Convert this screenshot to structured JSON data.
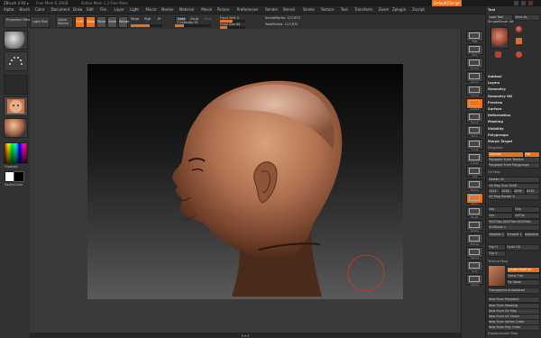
{
  "titlebar": {
    "app": "ZBrush 4 R4 ▸",
    "segments": [
      "Free Mem 6.39GB",
      "Active Mem 1.2 Free Mem",
      "Tool",
      "Poly 21,974",
      "Timer"
    ],
    "default_script": "DefaultZScript"
  },
  "menu": [
    "Alpha",
    "Brush",
    "Color",
    "Document",
    "Draw",
    "Edit",
    "File",
    "Layer",
    "Light",
    "Macro",
    "Marker",
    "Material",
    "Movie",
    "Picture",
    "Preferences",
    "Render",
    "Stencil",
    "Stroke",
    "Texture",
    "Tool",
    "Transform",
    "Zoom",
    "Zplugin",
    "Zscript"
  ],
  "toolbar": {
    "projection_master": "Projection Master",
    "lightbox": "Light Box",
    "quick_sketch": "Quick Sketch",
    "edit": "Edit",
    "draw": "Draw",
    "move": "Move",
    "scale": "Scale",
    "rotate": "Rotate",
    "mrgb": "Mrgb",
    "rgb": "Rgb",
    "m": "M",
    "rgb_intensity": "Rgb Intensity",
    "zadd": "Zadd",
    "zsub": "Zsub",
    "zcut": "Zcut",
    "z_intensity": "Z Intensity 25",
    "focal_shift": "Focal Shift 0",
    "draw_size": "Draw Size 64",
    "active_points": "ActivePoints: 127,872",
    "total_points": "TotalPoints: 127,872"
  },
  "leftshelf": {
    "alpha_off": "Alpha Off",
    "texture_off": "Texture Off",
    "material": "MatCap Skin",
    "gradient": "Gradient",
    "switch_color": "SwitchColor"
  },
  "rightshelf": [
    "BPR",
    "SPix",
    "Scroll",
    "Zoom",
    "Actual",
    "AAHalf",
    "Persp",
    "Floor",
    "Local",
    "L.Sym",
    "Xyz",
    "Frame",
    "Move",
    "Scale",
    "Rotate",
    "Transp",
    "Ghost",
    "Solo",
    "Xpose"
  ],
  "tray": {
    "header": "Tool",
    "load_tool": "Load Tool",
    "save_as": "Save As",
    "simplebrush": "SimpleBrush 48",
    "tool_names": [
      "Sphere3D",
      "PolyMesh3D",
      "Cylinder3D",
      "Head"
    ],
    "sections": [
      "Subtool",
      "Layers",
      "Geometry",
      "Geometry HD",
      "Preview",
      "Surface",
      "Deformation",
      "Masking",
      "Visibility",
      "Polygroups",
      "Morph Target"
    ],
    "polypaint": "Polypaint",
    "colorize": "Colorize",
    "grd": "Grd",
    "polypaint_from_texture": "Polypaint From Texture",
    "polypaint_from_polygroups": "Polypaint From Polygroups",
    "uv_map": "UV Map",
    "delete_uv": "Delete UV",
    "uv_map_size": "UV Map Size 2048",
    "sizes": [
      "1024",
      "2048",
      "4096",
      "8192"
    ],
    "uv_map_border": "UV Map Border 4",
    "uvs": "Uvs",
    "uvp": "UVp",
    "uvc": "Uvc",
    "uvtile": "UVTile",
    "pasting": "PUVTiles  AUVTiles  GUVTiles",
    "adaptive": "AUVRatio 1",
    "hrepeat": "Hrepeat 1",
    "vrepeat": "Vrepeat 1",
    "adaptive2": "Adaptive",
    "flip_h": "Flip H",
    "cycle_uv": "Cycle UV",
    "flip_v": "Flip V",
    "texture_map": "Texture Map",
    "new_texture": "Create NewTxtr",
    "new_from_polypaint": "New From Polypaint",
    "new_from_masking": "New From Masking",
    "new_from_uv_map": "New From UV Map",
    "new_from_uv_check": "New From UV Check",
    "new_from_vertex_order": "New From Vertex Order",
    "new_from_poly_order": "New From Poly Order",
    "clone_txtr": "Clone Txtr",
    "fix_seam": "Fix Seam",
    "transparent": "Transparent",
    "antialiased": "Antialiased",
    "displacement_map": "Displacement Map"
  },
  "colors": {
    "accent": "#e8711a",
    "bg": "#2b2b2b",
    "panel": "#323232"
  }
}
